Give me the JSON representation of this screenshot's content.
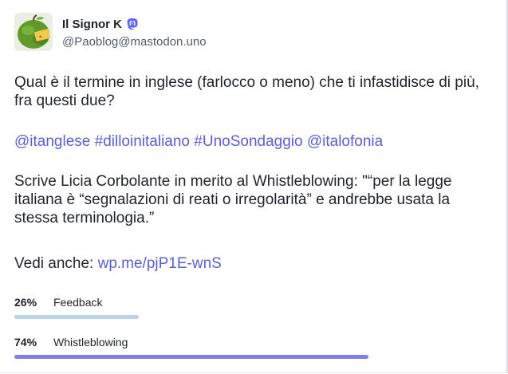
{
  "author": {
    "display_name": "Il Signor K",
    "handle": "@Paoblog@mastodon.uno",
    "badge_icon": "mastodon-icon",
    "avatar_icon": "green-apple-avatar"
  },
  "post": {
    "p1": "Qual è il termine in inglese (farlocco o meno) che ti infastidisce di più, fra questi due?",
    "hashtags": [
      "@itanglese",
      "#dilloinitaliano",
      "#UnoSondaggio",
      "@italofonia"
    ],
    "p3": "Scrive Licia Corbolante in merito al Whistleblowing: \"“per la legge italiana è “segnalazioni di reati o irregolarità” e andrebbe usata la stessa terminologia.”",
    "see_also_label": "Vedi anche:",
    "see_also_link": "wp.me/pjP1E-wnS"
  },
  "poll": {
    "options": [
      {
        "percent": "26%",
        "label": "Feedback",
        "fraction": 0.26,
        "color": "#b9d3ee"
      },
      {
        "percent": "74%",
        "label": "Whistleblowing",
        "fraction": 0.74,
        "color": "#7c7ff0"
      }
    ]
  },
  "colors": {
    "link": "#5b5fd6",
    "mastodon_badge": "#6364ff"
  }
}
